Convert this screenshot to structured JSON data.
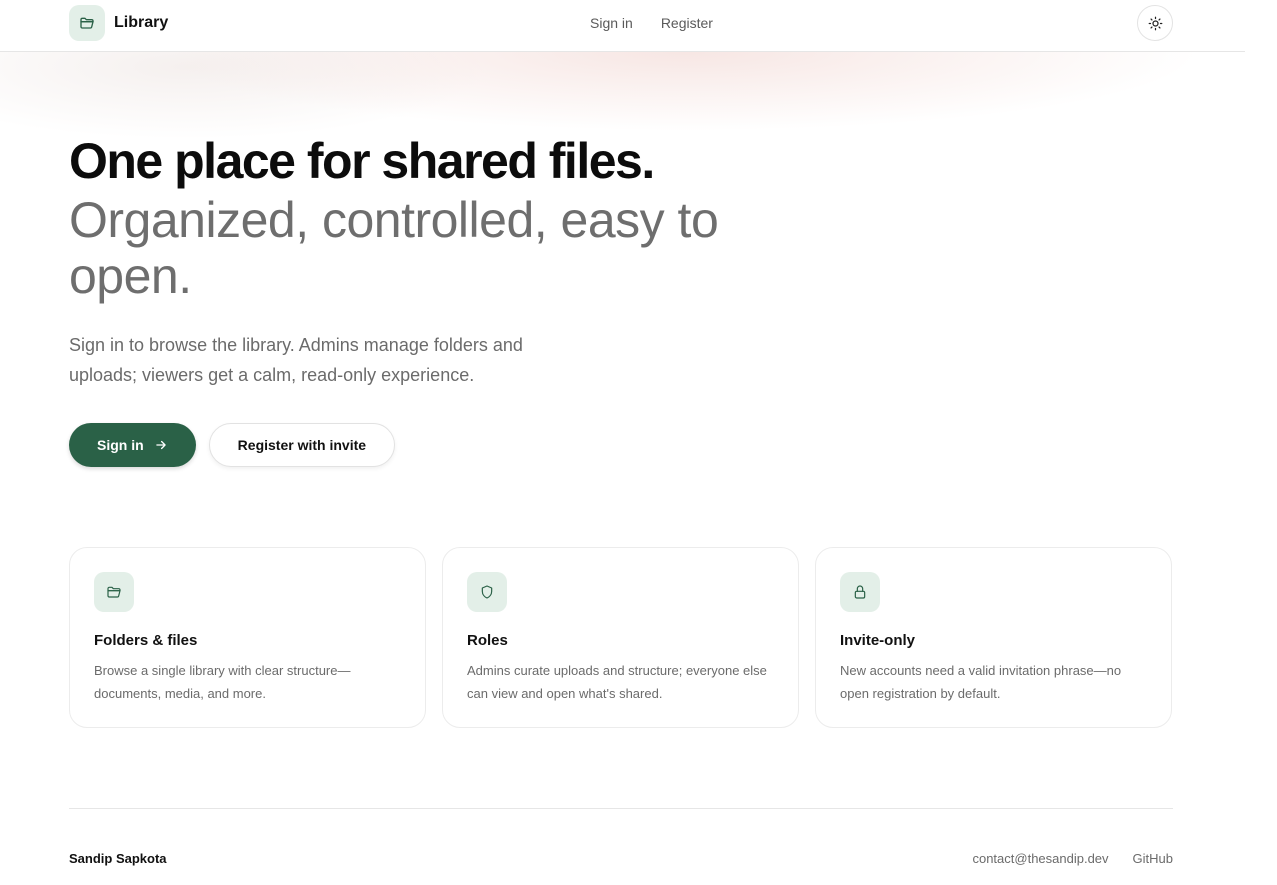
{
  "app": {
    "name": "Library"
  },
  "nav": {
    "sign_in": "Sign in",
    "register": "Register"
  },
  "hero": {
    "title": "One place for shared files.",
    "subtitle": "Organized, controlled, easy to open.",
    "description": "Sign in to browse the library. Admins manage folders and uploads; viewers get a calm, read-only experience."
  },
  "cta": {
    "primary": "Sign in",
    "secondary": "Register with invite"
  },
  "features": [
    {
      "icon": "folder-icon",
      "title": "Folders & files",
      "description": "Browse a single library with clear structure—documents, media, and more."
    },
    {
      "icon": "shield-icon",
      "title": "Roles",
      "description": "Admins curate uploads and structure; everyone else can view and open what's shared."
    },
    {
      "icon": "lock-icon",
      "title": "Invite-only",
      "description": "New accounts need a valid invitation phrase—no open registration by default."
    }
  ],
  "footer": {
    "author": "Sandip Sapkota",
    "email": "contact@thesandip.dev",
    "github": "GitHub"
  },
  "colors": {
    "accent": "#2a6147",
    "accent_soft": "#e3efe8"
  }
}
